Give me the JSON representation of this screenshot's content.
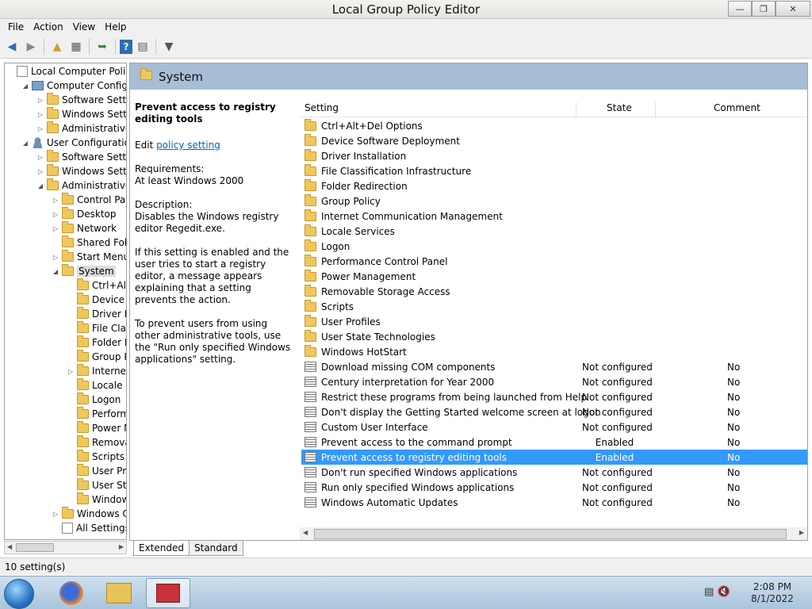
{
  "window": {
    "title": "Local Group Policy Editor"
  },
  "menu": [
    "File",
    "Action",
    "View",
    "Help"
  ],
  "tree": {
    "root": "Local Computer Policy",
    "items": [
      {
        "label": "Computer Configura",
        "depth": 1,
        "expanded": true,
        "icon": "computer"
      },
      {
        "label": "Software Settings",
        "depth": 2,
        "expanded": false,
        "icon": "folder"
      },
      {
        "label": "Windows Setting",
        "depth": 2,
        "expanded": false,
        "icon": "folder"
      },
      {
        "label": "Administrative Te",
        "depth": 2,
        "expanded": false,
        "icon": "folder"
      },
      {
        "label": "User Configuration",
        "depth": 1,
        "expanded": true,
        "icon": "user"
      },
      {
        "label": "Software Settings",
        "depth": 2,
        "expanded": false,
        "icon": "folder"
      },
      {
        "label": "Windows Setting",
        "depth": 2,
        "expanded": false,
        "icon": "folder"
      },
      {
        "label": "Administrative Te",
        "depth": 2,
        "expanded": true,
        "icon": "folder"
      },
      {
        "label": "Control Panel",
        "depth": 3,
        "expanded": false,
        "icon": "folder"
      },
      {
        "label": "Desktop",
        "depth": 3,
        "expanded": false,
        "icon": "folder"
      },
      {
        "label": "Network",
        "depth": 3,
        "expanded": false,
        "icon": "folder"
      },
      {
        "label": "Shared Folder",
        "depth": 3,
        "expanded": null,
        "icon": "folder"
      },
      {
        "label": "Start Menu ar",
        "depth": 3,
        "expanded": false,
        "icon": "folder"
      },
      {
        "label": "System",
        "depth": 3,
        "expanded": true,
        "icon": "folder",
        "selected": true
      },
      {
        "label": "Ctrl+Alt+I",
        "depth": 4,
        "expanded": null,
        "icon": "folder"
      },
      {
        "label": "Device So",
        "depth": 4,
        "expanded": null,
        "icon": "folder"
      },
      {
        "label": "Driver Inst",
        "depth": 4,
        "expanded": null,
        "icon": "folder"
      },
      {
        "label": "File Classi",
        "depth": 4,
        "expanded": null,
        "icon": "folder"
      },
      {
        "label": "Folder Red",
        "depth": 4,
        "expanded": null,
        "icon": "folder"
      },
      {
        "label": "Group Pol",
        "depth": 4,
        "expanded": null,
        "icon": "folder"
      },
      {
        "label": "Internet C",
        "depth": 4,
        "expanded": false,
        "icon": "folder"
      },
      {
        "label": "Locale Ser",
        "depth": 4,
        "expanded": null,
        "icon": "folder"
      },
      {
        "label": "Logon",
        "depth": 4,
        "expanded": null,
        "icon": "folder"
      },
      {
        "label": "Performar",
        "depth": 4,
        "expanded": null,
        "icon": "folder"
      },
      {
        "label": "Power Ma",
        "depth": 4,
        "expanded": null,
        "icon": "folder"
      },
      {
        "label": "Removabl",
        "depth": 4,
        "expanded": null,
        "icon": "folder"
      },
      {
        "label": "Scripts",
        "depth": 4,
        "expanded": null,
        "icon": "folder"
      },
      {
        "label": "User Profi",
        "depth": 4,
        "expanded": null,
        "icon": "folder"
      },
      {
        "label": "User State",
        "depth": 4,
        "expanded": null,
        "icon": "folder"
      },
      {
        "label": "Windows",
        "depth": 4,
        "expanded": null,
        "icon": "folder"
      },
      {
        "label": "Windows Cor",
        "depth": 3,
        "expanded": false,
        "icon": "folder"
      },
      {
        "label": "All Settings",
        "depth": 3,
        "expanded": null,
        "icon": "doc"
      }
    ]
  },
  "main": {
    "header_title": "System",
    "description": {
      "title": "Prevent access to registry editing tools",
      "edit_prefix": "Edit ",
      "edit_link": "policy setting ",
      "requirements_label": "Requirements:",
      "requirements_value": "At least Windows 2000",
      "description_label": "Description:",
      "description_text": "Disables the Windows registry editor Regedit.exe.",
      "para2": "If this setting is enabled and the user tries to start a registry editor, a message appears explaining that a setting prevents the action.",
      "para3": "To prevent users from using other administrative tools, use the \"Run only specified Windows applications\" setting."
    },
    "columns": {
      "setting": "Setting",
      "state": "State",
      "comment": "Comment"
    },
    "folders": [
      "Ctrl+Alt+Del Options",
      "Device Software Deployment",
      "Driver Installation",
      "File Classification Infrastructure",
      "Folder Redirection",
      "Group Policy",
      "Internet Communication Management",
      "Locale Services",
      "Logon",
      "Performance Control Panel",
      "Power Management",
      "Removable Storage Access",
      "Scripts",
      "User Profiles",
      "User State Technologies",
      "Windows HotStart"
    ],
    "policies": [
      {
        "name": "Download missing COM components",
        "state": "Not configured",
        "comment": "No"
      },
      {
        "name": "Century interpretation for Year 2000",
        "state": "Not configured",
        "comment": "No"
      },
      {
        "name": "Restrict these programs from being launched from Help",
        "state": "Not configured",
        "comment": "No"
      },
      {
        "name": "Don't display the Getting Started welcome screen at logon",
        "state": "Not configured",
        "comment": "No"
      },
      {
        "name": "Custom User Interface",
        "state": "Not configured",
        "comment": "No"
      },
      {
        "name": "Prevent access to the command prompt",
        "state": "Enabled",
        "comment": "No"
      },
      {
        "name": "Prevent access to registry editing tools",
        "state": "Enabled",
        "comment": "No",
        "selected": true
      },
      {
        "name": "Don't run specified Windows applications",
        "state": "Not configured",
        "comment": "No"
      },
      {
        "name": "Run only specified Windows applications",
        "state": "Not configured",
        "comment": "No"
      },
      {
        "name": "Windows Automatic Updates",
        "state": "Not configured",
        "comment": "No"
      }
    ]
  },
  "tabs": [
    "Extended",
    "Standard"
  ],
  "status": {
    "text": "10 setting(s)"
  },
  "taskbar": {
    "time": "2:08 PM",
    "date": "8/1/2022"
  },
  "colors": {
    "selection": "#3399ff",
    "header_band": "#a7bed6",
    "link": "#0066cc"
  }
}
